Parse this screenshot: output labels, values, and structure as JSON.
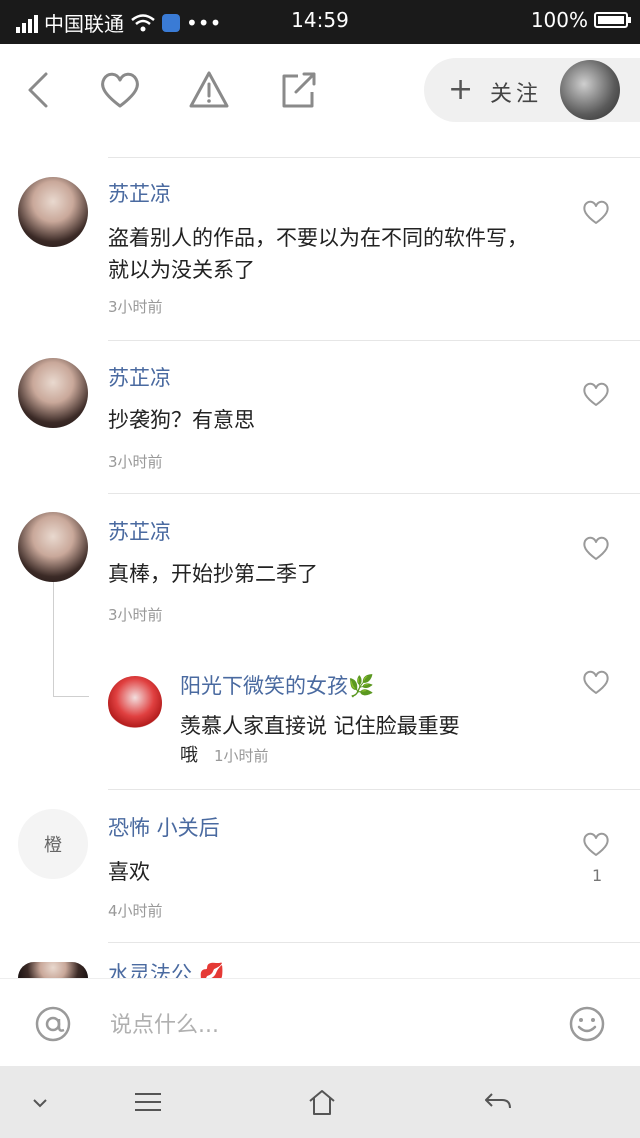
{
  "status": {
    "carrier": "中国联通",
    "time": "14:59",
    "battery": "100%",
    "battery_level": 1.0
  },
  "header": {
    "follow_label": "关注"
  },
  "comments": [
    {
      "name": "苏芷凉",
      "text": "盗着别人的作品，不要以为在不同的软件写，就以为没关系了",
      "time": "3小时前"
    },
    {
      "name": "苏芷凉",
      "text": "抄袭狗？有意思",
      "time": "3小时前"
    },
    {
      "name": "苏芷凉",
      "text": "真棒，开始抄第二季了",
      "time": "3小时前",
      "reply": {
        "name": "阳光下微笑的女孩🌿",
        "text": "羡慕人家直接说 记住脸最重要",
        "extra": "哦",
        "time": "1小时前"
      }
    },
    {
      "name": "恐怖 小关后",
      "avatar_text": "橙",
      "text": "喜欢",
      "time": "4小时前",
      "likes": "1"
    }
  ],
  "partial": {
    "name": "水灵法公 💋"
  },
  "input": {
    "placeholder": "说点什么..."
  },
  "icons": {
    "back": "back-arrow-icon",
    "like": "heart-icon",
    "report": "warning-icon",
    "share": "share-icon",
    "at": "at-icon",
    "emoji": "emoji-icon"
  }
}
